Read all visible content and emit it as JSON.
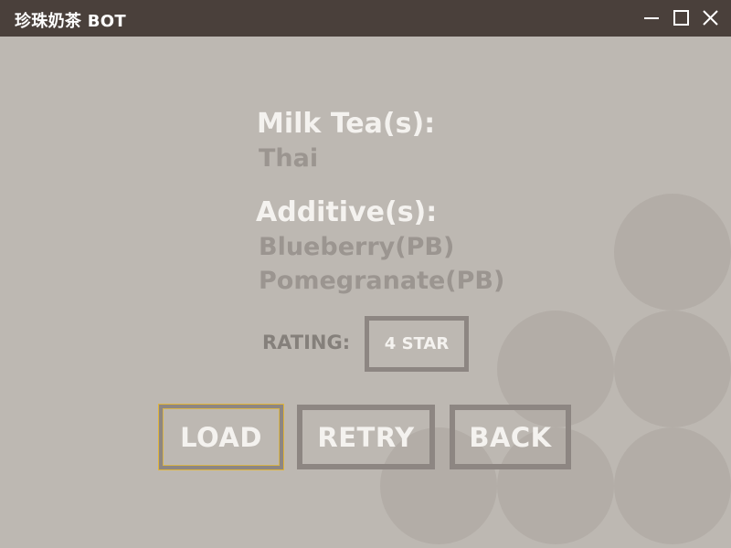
{
  "window": {
    "title": "珍珠奶茶 BOT",
    "controls": {
      "minimize": "minimize-icon",
      "maximize": "maximize-icon",
      "close": "close-icon"
    }
  },
  "result": {
    "milk_tea_heading": "Milk Tea(s):",
    "milk_teas": [
      "Thai"
    ],
    "additive_heading": "Additive(s):",
    "additives": [
      "Blueberry(PB)",
      "Pomegranate(PB)"
    ],
    "rating_label": "RATING:",
    "rating_value": "4 STAR"
  },
  "buttons": {
    "load": "LOAD",
    "retry": "RETRY",
    "back": "BACK"
  },
  "colors": {
    "titlebar": "#4a403b",
    "background": "#bdb8b2",
    "bubble": "#b3ada7",
    "button_border": "#8d8682",
    "focus_highlight": "#e1b53a",
    "heading_text": "#f4f2ef",
    "value_text": "#9b9590"
  }
}
